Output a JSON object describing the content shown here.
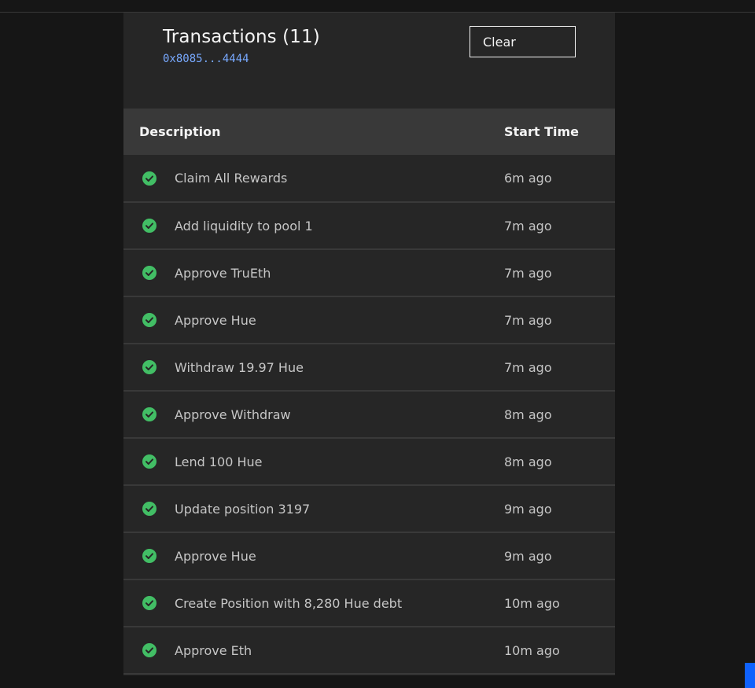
{
  "panel": {
    "title": "Transactions (11)",
    "address": "0x8085...4444",
    "clear_label": "Clear"
  },
  "table": {
    "headers": {
      "description": "Description",
      "start_time": "Start Time"
    },
    "rows": [
      {
        "status": "success",
        "description": "Claim All Rewards",
        "start_time": "6m ago"
      },
      {
        "status": "success",
        "description": "Add liquidity to pool 1",
        "start_time": "7m ago"
      },
      {
        "status": "success",
        "description": "Approve TruEth",
        "start_time": "7m ago"
      },
      {
        "status": "success",
        "description": "Approve Hue",
        "start_time": "7m ago"
      },
      {
        "status": "success",
        "description": "Withdraw 19.97 Hue",
        "start_time": "7m ago"
      },
      {
        "status": "success",
        "description": "Approve Withdraw",
        "start_time": "8m ago"
      },
      {
        "status": "success",
        "description": "Lend 100 Hue",
        "start_time": "8m ago"
      },
      {
        "status": "success",
        "description": "Update position 3197",
        "start_time": "9m ago"
      },
      {
        "status": "success",
        "description": "Approve Hue",
        "start_time": "9m ago"
      },
      {
        "status": "success",
        "description": "Create Position with 8,280 Hue debt",
        "start_time": "10m ago"
      },
      {
        "status": "success",
        "description": "Approve Eth",
        "start_time": "10m ago"
      }
    ]
  },
  "icons": {
    "status_success": "checkmark-circle-icon"
  },
  "colors": {
    "background": "#161616",
    "panel": "#262626",
    "header_row": "#393939",
    "success": "#42be65",
    "link": "#78a9ff",
    "accent": "#0f62fe"
  }
}
